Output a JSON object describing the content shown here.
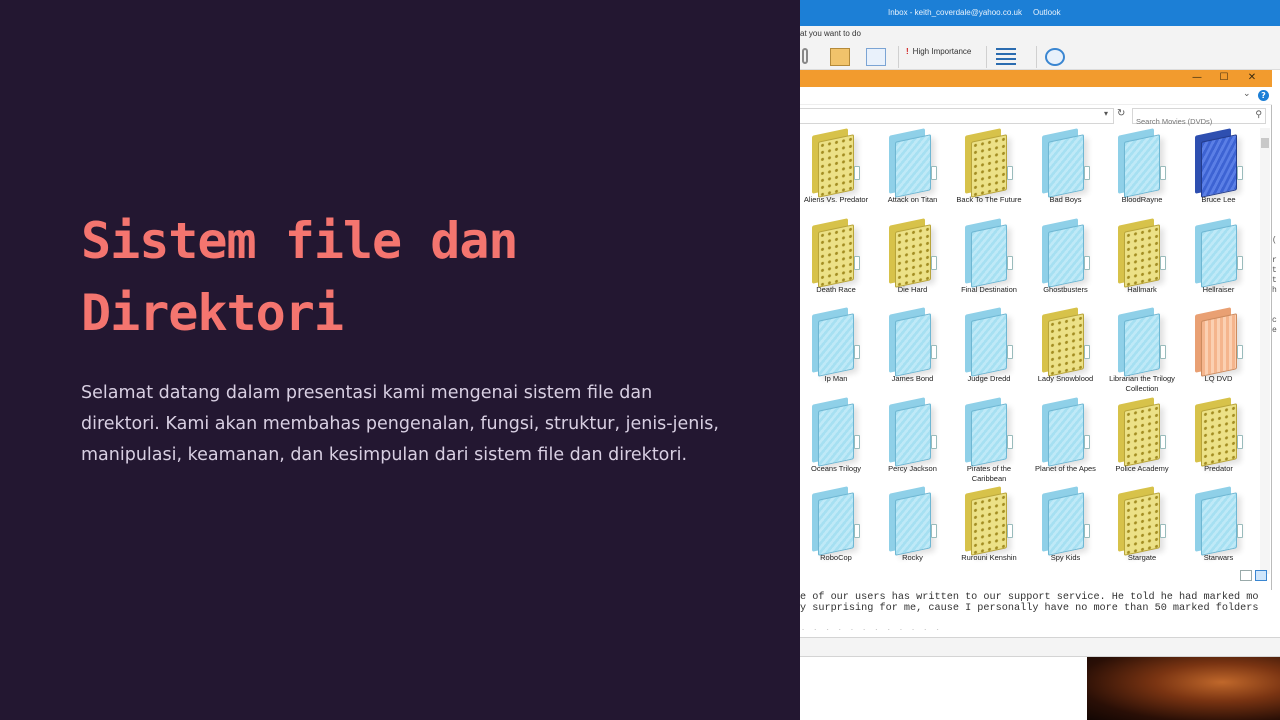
{
  "slide": {
    "title": "Sistem file dan Direktori",
    "body": "Selamat datang dalam presentasi kami mengenai sistem file dan direktori. Kami akan membahas pengenalan, fungsi, struktur, jenis-jenis, manipulasi, keamanan, dan kesimpulan dari sistem file dan direktori."
  },
  "colors": {
    "background": "#231731",
    "title": "#f4756f",
    "body_text": "#d8cfe2",
    "outlook_blue": "#1c7fd6",
    "explorer_orange": "#f29b2e"
  },
  "outlook": {
    "window_title": "Inbox - keith_coverdale@yahoo.co.uk",
    "app_name": "Outlook",
    "tell_me": "at you want to do",
    "high_importance": "High Importance"
  },
  "explorer": {
    "search_placeholder": "Search Movies (DVDs)",
    "window_controls": [
      "—",
      "☐",
      "✕"
    ],
    "folders": [
      {
        "label": "Aliens Vs. Predator",
        "color": "yellow"
      },
      {
        "label": "Attack on Titan",
        "color": "blue"
      },
      {
        "label": "Back To The Future",
        "color": "yellow"
      },
      {
        "label": "Bad Boys",
        "color": "blue"
      },
      {
        "label": "BloodRayne",
        "color": "blue"
      },
      {
        "label": "Bruce Lee",
        "color": "navy"
      },
      {
        "label": "Death Race",
        "color": "yellow"
      },
      {
        "label": "Die Hard",
        "color": "yellow"
      },
      {
        "label": "Final Destination",
        "color": "blue"
      },
      {
        "label": "Ghostbusters",
        "color": "blue"
      },
      {
        "label": "Hallmark",
        "color": "yellow"
      },
      {
        "label": "Hellraiser",
        "color": "blue"
      },
      {
        "label": "Ip Man",
        "color": "blue"
      },
      {
        "label": "James Bond",
        "color": "blue"
      },
      {
        "label": "Judge Dredd",
        "color": "blue"
      },
      {
        "label": "Lady Snowblood",
        "color": "yellow"
      },
      {
        "label": "Librarian the Trilogy Collection",
        "color": "blue"
      },
      {
        "label": "LQ DVD",
        "color": "orange"
      },
      {
        "label": "Oceans  Trilogy",
        "color": "blue"
      },
      {
        "label": "Percy Jackson",
        "color": "blue"
      },
      {
        "label": "Pirates of the Caribbean",
        "color": "blue"
      },
      {
        "label": "Planet of the Apes",
        "color": "blue"
      },
      {
        "label": "Police Academy",
        "color": "yellow"
      },
      {
        "label": "Predator",
        "color": "yellow"
      },
      {
        "label": "RoboCop",
        "color": "blue"
      },
      {
        "label": "Rocky",
        "color": "blue"
      },
      {
        "label": "Rurouni Kenshin",
        "color": "yellow"
      },
      {
        "label": "Spy Kids",
        "color": "blue"
      },
      {
        "label": "Stargate",
        "color": "yellow"
      },
      {
        "label": "Starwars",
        "color": "blue"
      }
    ]
  },
  "email": {
    "line1": "e of our users has written to our support service. He told he had marked mo",
    "line2": "y surprising for me, cause I personally have no more than 50 marked folders",
    "line3": "  . .  .  .     . .     .        .      .        .    .   .  "
  },
  "right_strip": {
    "chars": [
      "(",
      "",
      "r",
      "t",
      "t",
      "h",
      "",
      "",
      "c",
      "e"
    ]
  }
}
